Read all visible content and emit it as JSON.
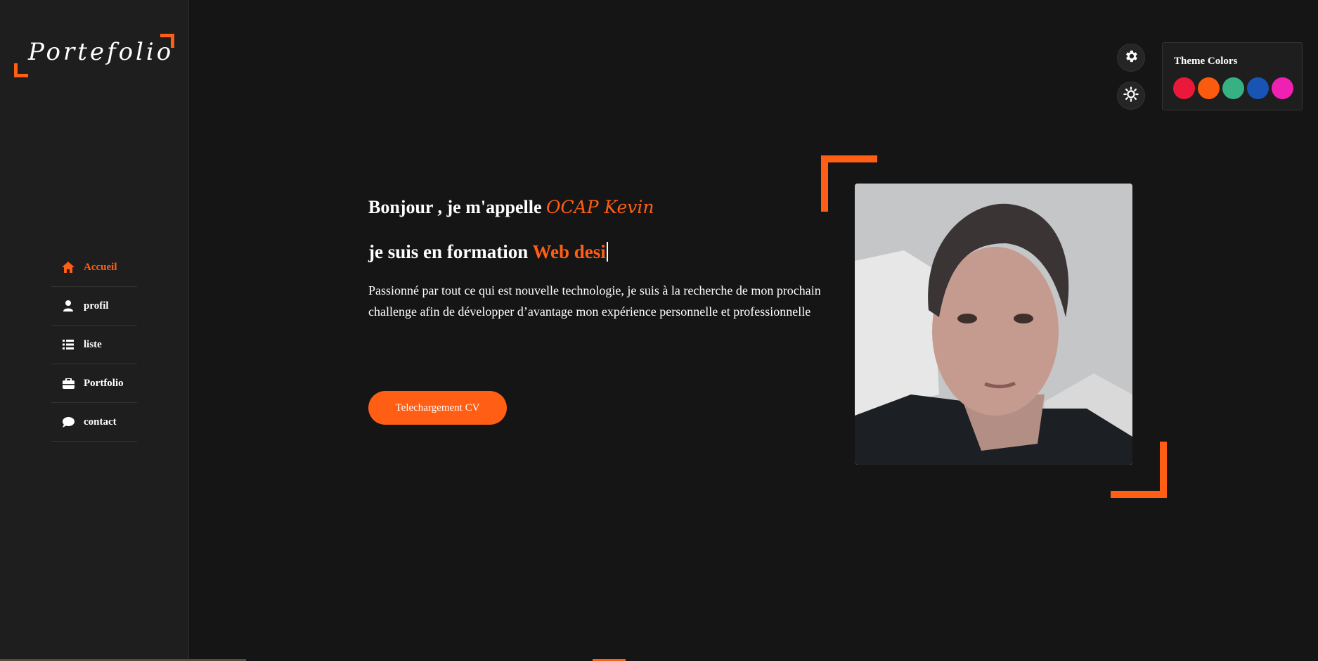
{
  "sidebar": {
    "logo_text": "Portefolio",
    "items": [
      {
        "label": "Accueil",
        "icon": "home-icon",
        "active": true
      },
      {
        "label": "profil",
        "icon": "user-icon",
        "active": false
      },
      {
        "label": "liste",
        "icon": "list-icon",
        "active": false
      },
      {
        "label": "Portfolio",
        "icon": "briefcase-icon",
        "active": false
      },
      {
        "label": "contact",
        "icon": "chat-icon",
        "active": false
      }
    ]
  },
  "theme": {
    "title": "Theme Colors",
    "swatches": [
      "#ec1839",
      "#fa5b0f",
      "#37b182",
      "#1854b4",
      "#f021b2"
    ],
    "accent": "#ff5e14"
  },
  "hero": {
    "greeting": "Bonjour , je m'appelle ",
    "name": "OCAP Kevin",
    "formation_prefix": "je suis en formation ",
    "formation_typed": "Web desi",
    "description": "Passionné par tout ce qui est nouvelle technologie, je suis à la recherche de mon prochain challenge afin de développer d’avantage mon expérience personnelle et professionnelle",
    "cv_button": "Telechargement CV"
  }
}
